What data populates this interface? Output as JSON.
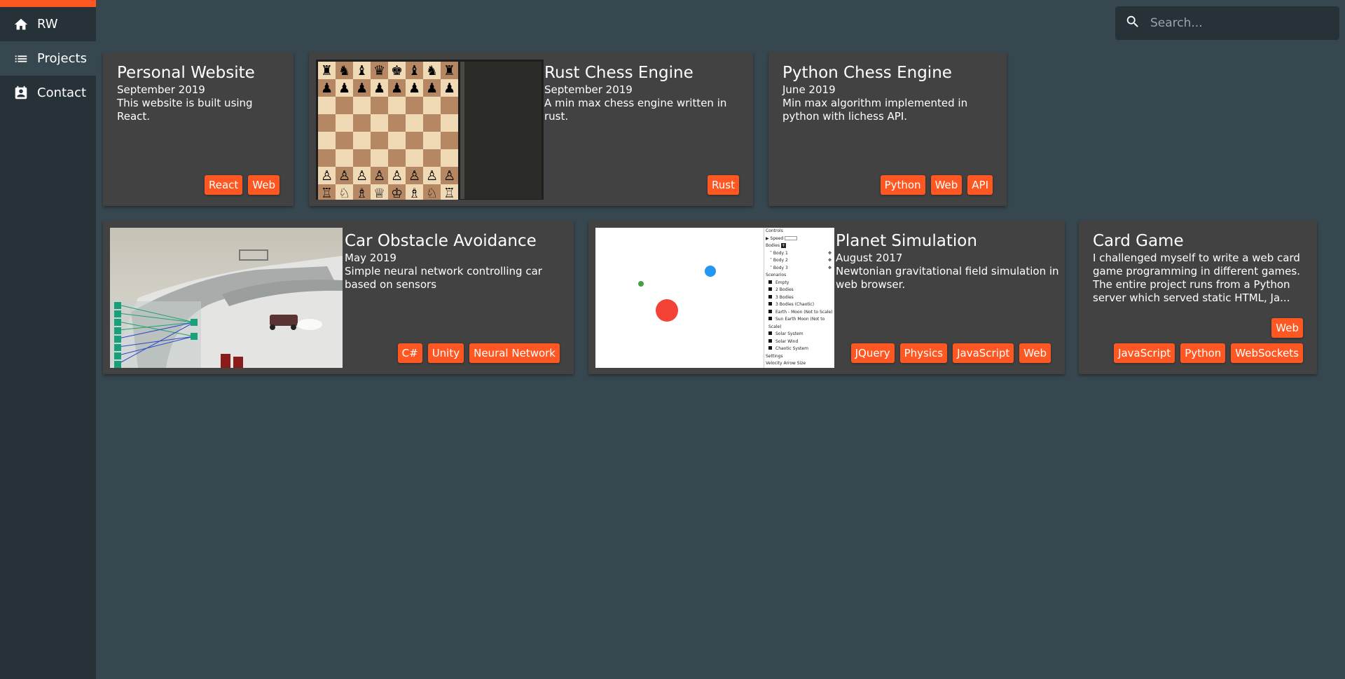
{
  "sidebar": {
    "items": [
      {
        "label": "RW",
        "icon": "home-icon"
      },
      {
        "label": "Projects",
        "icon": "list-icon"
      },
      {
        "label": "Contact",
        "icon": "contact-card-icon"
      }
    ],
    "active": "Projects",
    "accent": "#ff5722"
  },
  "search": {
    "placeholder": "Search...",
    "value": ""
  },
  "colors": {
    "background": "#37474f",
    "sidebar": "#263238",
    "card": "#424242",
    "tag": "#ff5722"
  },
  "projects": [
    {
      "title": "Personal Website",
      "date": "September 2019",
      "description": "This website is built using React.",
      "tags": [
        "React",
        "Web"
      ]
    },
    {
      "title": "Rust Chess Engine",
      "date": "September 2019",
      "description": "A min max chess engine written in rust.",
      "tags": [
        "Rust"
      ]
    },
    {
      "title": "Python Chess Engine",
      "date": "June 2019",
      "description": "Min max algorithm implemented in python with lichess API.",
      "tags": [
        "Python",
        "Web",
        "API"
      ]
    },
    {
      "title": "Car Obstacle Avoidance",
      "date": "May 2019",
      "description": "Simple neural network controlling car based on sensors",
      "tags": [
        "C#",
        "Unity",
        "Neural Network"
      ]
    },
    {
      "title": "Planet Simulation",
      "date": "August 2017",
      "description": "Newtonian gravitational field simulation in web browser.",
      "tags": [
        "JQuery",
        "Physics",
        "JavaScript",
        "Web"
      ]
    },
    {
      "title": "Card Game",
      "date": "",
      "description": "I challenged myself to write a web card game programming in different games. The entire project runs from a Python server which served static HTML, Ja...",
      "tags_row1": [
        "Web"
      ],
      "tags_row2": [
        "JavaScript",
        "Python",
        "WebSockets"
      ]
    }
  ],
  "planet_panel": {
    "controls": "Controls",
    "speed": "Speed",
    "bodies": "Bodies",
    "body_items": [
      "Body 1",
      "Body 2",
      "Body 3"
    ],
    "scenarios": "Scenarios",
    "scenario_items": [
      "Empty",
      "2 Bodies",
      "3 Bodies",
      "3 Bodies (Chaotic)",
      "Earth - Moon (Not to Scale)",
      "Sun Earth Moon (Not to Scale)",
      "Solar System",
      "Solar Wind",
      "Chaotic System"
    ],
    "settings": "Settings",
    "velocity": "Velocity Arrow Size"
  }
}
